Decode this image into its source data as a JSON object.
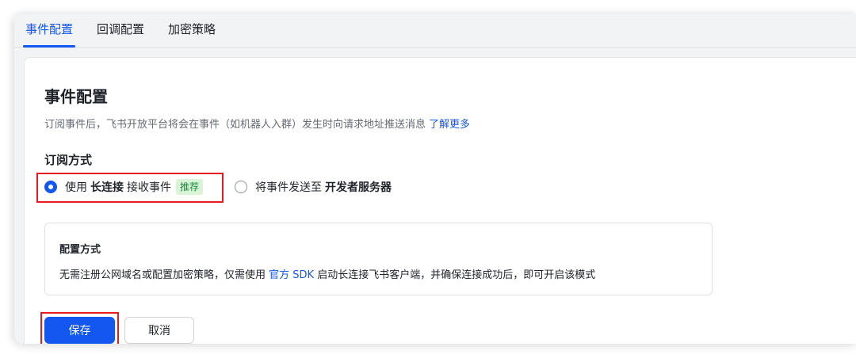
{
  "tabs": [
    {
      "label": "事件配置",
      "active": true
    },
    {
      "label": "回调配置",
      "active": false
    },
    {
      "label": "加密策略",
      "active": false
    }
  ],
  "section": {
    "title": "事件配置",
    "description": "订阅事件后，飞书开放平台将会在事件（如机器人入群）发生时向请求地址推送消息",
    "learn_more": "了解更多"
  },
  "subscription": {
    "title": "订阅方式",
    "option1": {
      "prefix": "使用",
      "bold": "长连接",
      "suffix": "接收事件",
      "badge": "推荐",
      "selected": true
    },
    "option2": {
      "prefix": "将事件发送至",
      "bold": "开发者服务器",
      "selected": false
    }
  },
  "config": {
    "title": "配置方式",
    "desc_before": "无需注册公网域名或配置加密策略，仅需使用 ",
    "desc_link": "官方 SDK",
    "desc_after": " 启动长连接飞书客户端，并确保连接成功后，即可开启该模式"
  },
  "buttons": {
    "save": "保存",
    "cancel": "取消"
  },
  "colors": {
    "accent": "#1456f0",
    "highlight": "#e5191e",
    "badge_bg": "#d9f5d6",
    "badge_text": "#1a8a41"
  }
}
